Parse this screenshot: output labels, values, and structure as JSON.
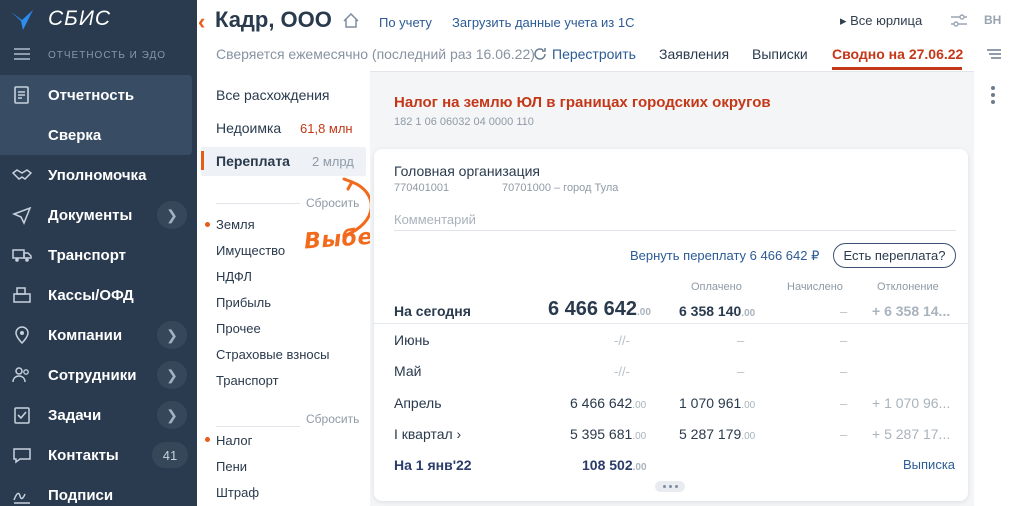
{
  "app": {
    "brand": "СБИС",
    "subbrand": "ОТЧЕТНОСТЬ И ЭДО"
  },
  "sidebar": {
    "items": [
      {
        "label": "Отчетность",
        "icon": "report-icon"
      },
      {
        "label": "Сверка"
      },
      {
        "label": "Уполномочка",
        "icon": "handshake-icon"
      },
      {
        "label": "Документы",
        "icon": "send-icon",
        "chevron": "❯"
      },
      {
        "label": "Транспорт",
        "icon": "truck-icon"
      },
      {
        "label": "Кассы/ОФД",
        "icon": "cash-register-icon"
      },
      {
        "label": "Компании",
        "icon": "location-pin-icon",
        "chevron": "❯"
      },
      {
        "label": "Сотрудники",
        "icon": "people-icon",
        "chevron": "❯"
      },
      {
        "label": "Задачи",
        "icon": "clipboard-check-icon",
        "chevron": "❯"
      },
      {
        "label": "Контакты",
        "icon": "chat-icon",
        "badge": "41"
      },
      {
        "label": "Подписи",
        "icon": "signature-icon"
      }
    ]
  },
  "header": {
    "back": "‹",
    "title": "Кадр, ООО",
    "links": [
      "По учету",
      "Загрузить данные учета из 1С"
    ],
    "all_entities": "▸ Все юрлица",
    "avatar": "ВН",
    "subtitle": "Сверяется ежемесячно (последний раз 16.06.22)",
    "rebuild": "Перестроить",
    "tabs": [
      "Заявления",
      "Выписки",
      "Сводно на 27.06.22"
    ]
  },
  "left_panel": {
    "all": "Все расхождения",
    "arrears_label": "Недоимка",
    "arrears_value": "61,8 млн",
    "overpay_label": "Переплата",
    "overpay_value": "2 млрд",
    "reset1": "Сбросить",
    "taxes": [
      "Земля",
      "Имущество",
      "НДФЛ",
      "Прибыль",
      "Прочее",
      "Страховые взносы",
      "Транспорт"
    ],
    "reset2": "Сбросить",
    "kinds": [
      "Налог",
      "Пени",
      "Штраф"
    ],
    "annotation": "Выберите"
  },
  "main": {
    "title": "Налог на землю ЮЛ в границах городских округов",
    "code": "182 1 06 06032 04 0000 110",
    "org": "Головная организация",
    "inn": "770401001",
    "oktmo": "70701000 – город Тула",
    "comment_placeholder": "Комментарий",
    "refund": "Вернуть переплату 6 466 642 ₽",
    "check_btn": "Есть переплата?",
    "columns": [
      "Оплачено",
      "Начислено",
      "Отклонение"
    ],
    "today_label": "На сегодня",
    "today_big": "6 466 642",
    "today_big_kop": ".00",
    "today_paid": "6 358 140",
    "today_paid_kop": ".00",
    "today_accr": "–",
    "today_dev": "+ 6 358 14...",
    "rows": [
      {
        "label": "Июнь",
        "v1": "-//-",
        "v2": "–",
        "v3": "–"
      },
      {
        "label": "Май",
        "v1": "-//-",
        "v2": "–",
        "v3": "–"
      },
      {
        "label": "Апрель",
        "v1": "6 466 642",
        "v1k": ".00",
        "v2": "1 070 961",
        "v2k": ".00",
        "v3": "–",
        "v4": "+ 1 070 96..."
      },
      {
        "label": "I квартал ›",
        "v1": "5 395 681",
        "v1k": ".00",
        "v2": "5 287 179",
        "v2k": ".00",
        "v3": "–",
        "v4": "+ 5 287 17..."
      }
    ],
    "jan_label": "На 1 янв'22",
    "jan_value": "108 502",
    "jan_kop": ".00",
    "statement": "Выписка"
  }
}
